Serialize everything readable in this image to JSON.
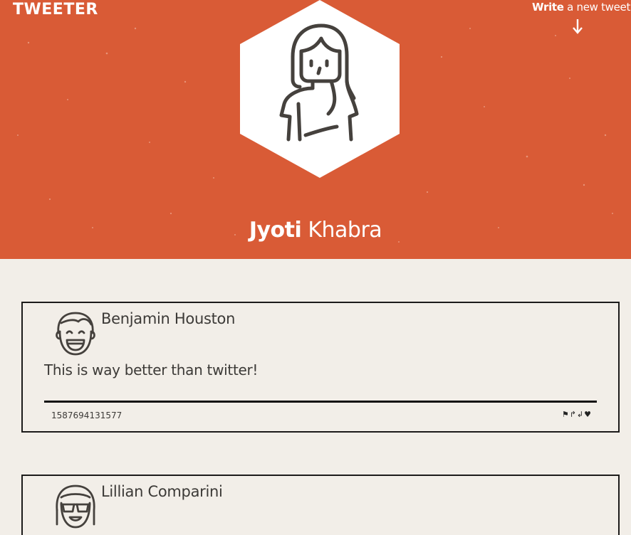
{
  "header": {
    "logo": "TWEETER",
    "write_strong": "Write",
    "write_rest": " a new tweet",
    "background_color": "#d95b36",
    "arrow_icon": "arrow-down-icon"
  },
  "profile": {
    "first_name": "Jyoti",
    "last_name": "Khabra",
    "avatar_icon": "woman-avatar-icon"
  },
  "tweets": [
    {
      "author": "Benjamin Houston",
      "avatar_icon": "smiling-man-avatar-icon",
      "text": "This is way better than twitter!",
      "timestamp": "1587694131577",
      "actions": {
        "flag": "⚑",
        "retweet": "↱",
        "reply": "↲",
        "like": "♥"
      }
    },
    {
      "author": "Lillian Comparini",
      "avatar_icon": "sunglasses-woman-avatar-icon"
    }
  ],
  "colors": {
    "accent": "#d95b36",
    "page_background": "#f2eee8",
    "text": "#3c3a37"
  }
}
